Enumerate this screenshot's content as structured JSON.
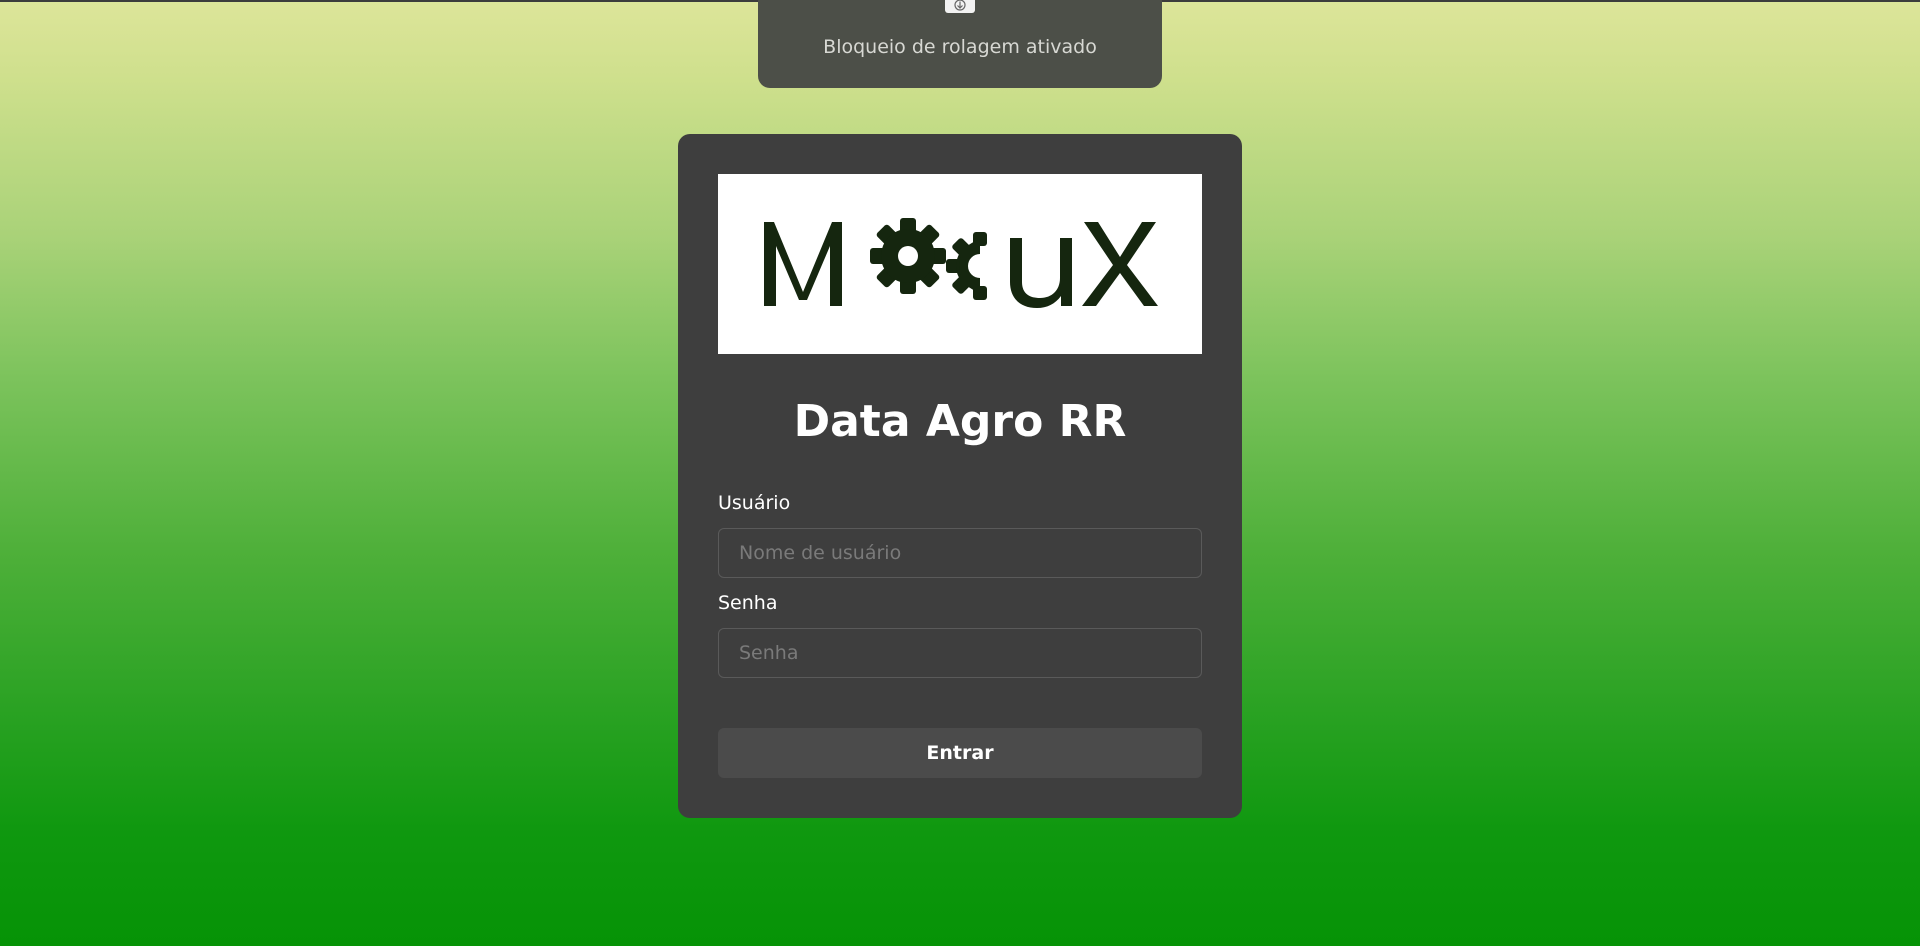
{
  "toast": {
    "text": "Bloqueio de rolagem ativado",
    "icon": "scroll-lock-icon"
  },
  "logo": {
    "text": "MocuX",
    "color": "#15260f"
  },
  "login": {
    "title": "Data Agro RR",
    "username_label": "Usuário",
    "username_placeholder": "Nome de usuário",
    "username_value": "",
    "password_label": "Senha",
    "password_placeholder": "Senha",
    "password_value": "",
    "submit_label": "Entrar"
  },
  "colors": {
    "card_bg": "#3e3e3e",
    "button_bg": "#4b4b4b",
    "gradient_top": "#dde59a",
    "gradient_bottom": "#069306"
  }
}
